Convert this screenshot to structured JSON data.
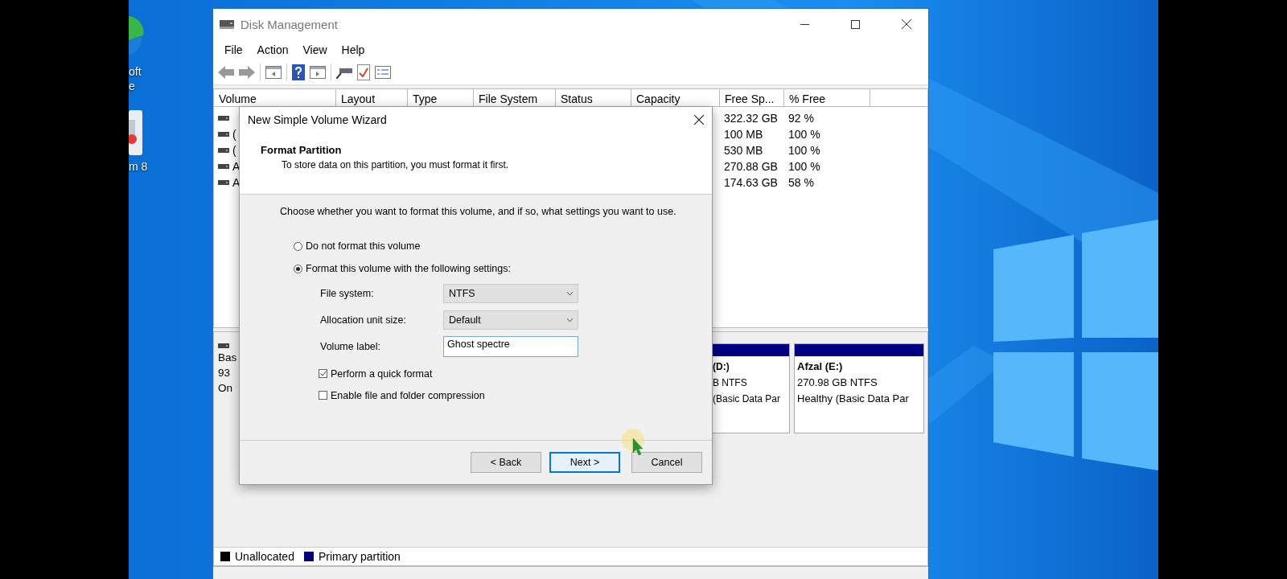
{
  "desktop_icons": [
    {
      "lines": [
        "oft",
        "e"
      ]
    },
    {
      "lines": [
        "m 8"
      ]
    }
  ],
  "window": {
    "title": "Disk Management"
  },
  "menu": [
    "File",
    "Action",
    "View",
    "Help"
  ],
  "table": {
    "columns": [
      "Volume",
      "Layout",
      "Type",
      "File System",
      "Status",
      "Capacity",
      "Free Sp...",
      "% Free"
    ],
    "rows": [
      {
        "free": "322.32 GB",
        "pct": "92 %"
      },
      {
        "volume": "(",
        "free": "100 MB",
        "pct": "100 %"
      },
      {
        "volume": "(",
        "free": "530 MB",
        "pct": "100 %"
      },
      {
        "volume": "A",
        "free": "270.88 GB",
        "pct": "100 %"
      },
      {
        "volume": "A",
        "free": "174.63 GB",
        "pct": "58 %"
      }
    ]
  },
  "disk": {
    "lines": [
      "Bas",
      "93",
      "On"
    ]
  },
  "partitions": [
    {
      "name": "(D:)",
      "size": "B NTFS",
      "status": "(Basic Data Par"
    },
    {
      "name": "Afzal  (E:)",
      "size": "270.98 GB NTFS",
      "status": "Healthy (Basic Data Par"
    }
  ],
  "legend": [
    {
      "label": "Unallocated",
      "color": "#000000"
    },
    {
      "label": "Primary partition",
      "color": "#000080"
    }
  ],
  "dialog": {
    "title": "New Simple Volume Wizard",
    "heading": "Format Partition",
    "subheading": "To store data on this partition, you must format it first.",
    "intro": "Choose whether you want to format this volume, and if so, what settings you want to use.",
    "options": [
      {
        "label": "Do not format this volume",
        "selected": false
      },
      {
        "label": "Format this volume with the following settings:",
        "selected": true
      }
    ],
    "fields": [
      {
        "kind": "select",
        "label": "File system:",
        "value": "NTFS"
      },
      {
        "kind": "select",
        "label": "Allocation unit size:",
        "value": "Default"
      },
      {
        "kind": "text",
        "label": "Volume label:",
        "value": "Ghost spectre"
      }
    ],
    "checks": [
      {
        "label": "Perform a quick format",
        "checked": true
      },
      {
        "label": "Enable file and folder compression",
        "checked": false
      }
    ],
    "buttons": [
      {
        "label": "< Back",
        "default": false
      },
      {
        "label": "Next >",
        "default": true
      },
      {
        "label": "Cancel",
        "default": false
      }
    ]
  }
}
